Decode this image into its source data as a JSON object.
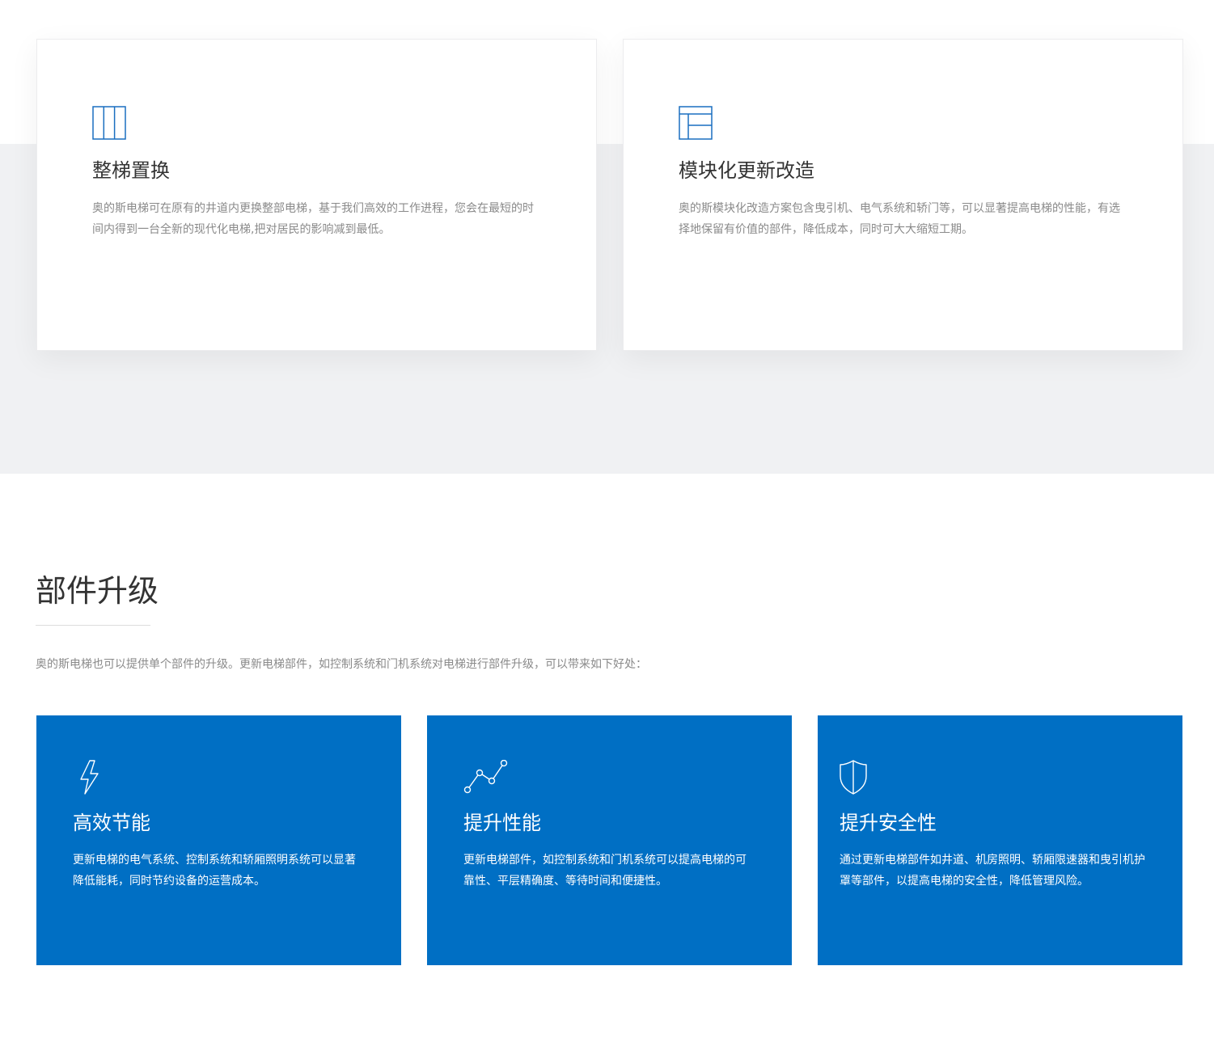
{
  "colors": {
    "accent_blue": "#006fc4",
    "band_gray": "#f0f1f3",
    "title_text": "#333333",
    "body_text": "#8a8a8a"
  },
  "modernization_cards": [
    {
      "icon": "column-layout-icon",
      "title": "整梯置换",
      "text": "奥的斯电梯可在原有的井道内更换整部电梯，基于我们高效的工作进程，您会在最短的时间内得到一台全新的现代化电梯,把对居民的影响减到最低。"
    },
    {
      "icon": "modular-layout-icon",
      "title": "模块化更新改造",
      "text": "奥的斯模块化改造方案包含曳引机、电气系统和轿门等，可以显著提高电梯的性能，有选择地保留有价值的部件，降低成本，同时可大大缩短工期。"
    }
  ],
  "upgrade_section": {
    "title": "部件升级",
    "intro": "奥的斯电梯也可以提供单个部件的升级。更新电梯部件，如控制系统和门机系统对电梯进行部件升级，可以带来如下好处："
  },
  "feature_cards": [
    {
      "icon": "lightning-bolt-icon",
      "title": "高效节能",
      "text": "更新电梯的电气系统、控制系统和轿厢照明系统可以显著降低能耗，同时节约设备的运营成本。"
    },
    {
      "icon": "line-chart-icon",
      "title": "提升性能",
      "text": "更新电梯部件，如控制系统和门机系统可以提高电梯的可靠性、平层精确度、等待时间和便捷性。"
    },
    {
      "icon": "shield-icon",
      "title": "提升安全性",
      "text": "通过更新电梯部件如井道、机房照明、轿厢限速器和曳引机护罩等部件，以提高电梯的安全性，降低管理风险。"
    }
  ]
}
